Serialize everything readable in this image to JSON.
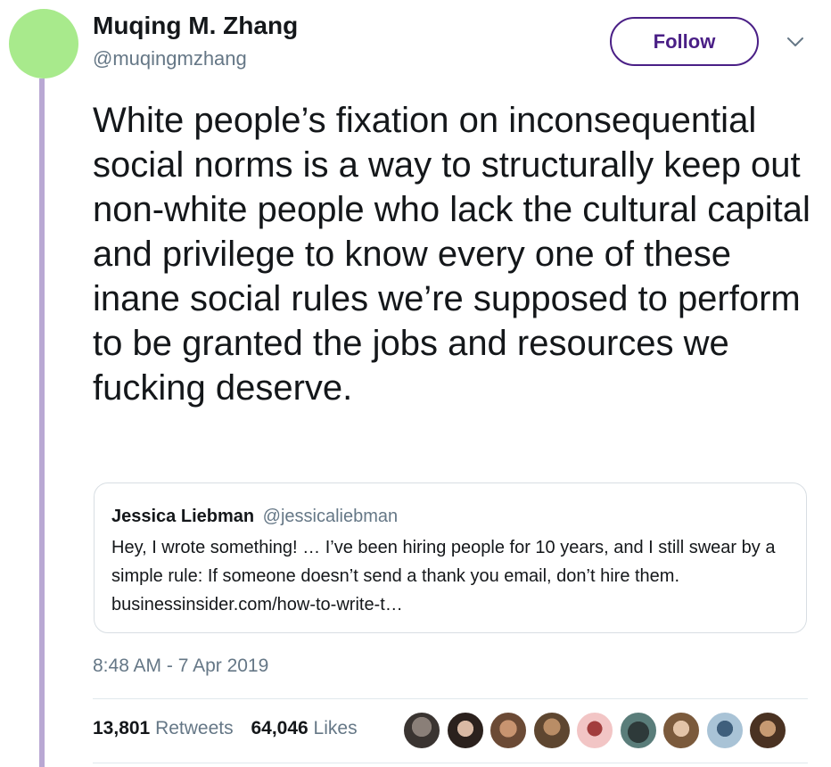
{
  "author": {
    "name": "Muqing M. Zhang",
    "handle": "@muqingmzhang"
  },
  "follow_label": "Follow",
  "tweet_text": "White people’s fixation on inconsequential social norms is a way to structurally keep out non-white people who lack the cultural capital and privilege to know every one of these inane social rules we’re supposed to perform to be granted the jobs and resources we fucking deserve.",
  "quoted_tweet": {
    "name": "Jessica Liebman",
    "handle": "@jessicaliebman",
    "text": "Hey, I wrote something! … I’ve been hiring people for 10 years, and I still swear by a simple rule: If someone doesn’t send a thank you email, don’t hire them. businessinsider.com/how-to-write-t…"
  },
  "timestamp": "8:48 AM - 7 Apr 2019",
  "stats": {
    "retweets_count": "13,801",
    "retweets_label": "Retweets",
    "likes_count": "64,046",
    "likes_label": "Likes"
  },
  "colors": {
    "avatar": "#a8ea8c",
    "thread_line": "#b9a8d3",
    "follow_accent": "#4a1f86",
    "secondary_text": "#657786"
  },
  "icons": {
    "caret": "chevron-down-icon"
  }
}
